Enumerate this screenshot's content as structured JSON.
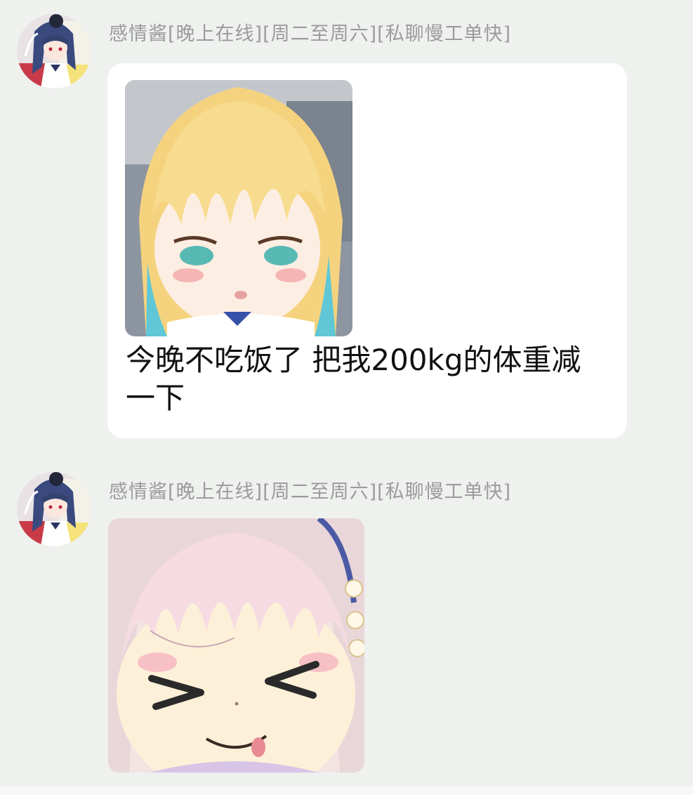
{
  "messages": [
    {
      "sender": "感情酱[晚上在线][周二至周六][私聊慢工单快]",
      "avatar": "avatar-icon",
      "image": "anime-sticker-blonde-girl",
      "text": "今晚不吃饭了  把我200kg的体重减一下"
    },
    {
      "sender": "感情酱[晚上在线][周二至周六][私聊慢工单快]",
      "avatar": "avatar-icon",
      "image": "anime-sticker-laughing-girl"
    }
  ],
  "colors": {
    "background": "#eef1ee",
    "bubble": "#ffffff",
    "sender_text": "#9b9b9b",
    "message_text": "#111111"
  }
}
